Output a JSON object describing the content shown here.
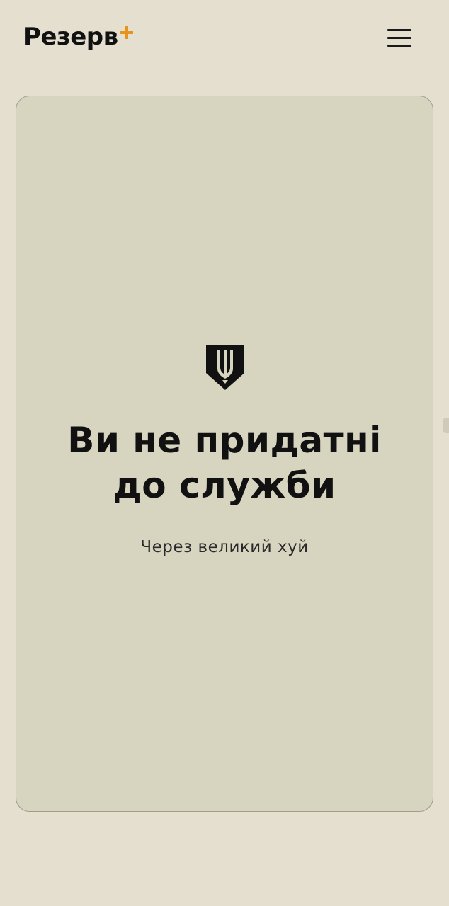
{
  "header": {
    "logo_text": "Резерв",
    "logo_mark_icon": "plus-icon",
    "logo_mark_color": "#e8921e",
    "menu_icon": "hamburger-menu-icon"
  },
  "card": {
    "emblem_icon": "trident-shield-emblem-icon",
    "headline_line1": "Ви не придатні",
    "headline_line2": "до служби",
    "subtitle": "Через великий хуй"
  },
  "colors": {
    "page_background": "#e4dfce",
    "card_background": "#d7d4c0",
    "card_border": "#9f9b8d",
    "text": "#111111",
    "accent": "#e8921e"
  }
}
